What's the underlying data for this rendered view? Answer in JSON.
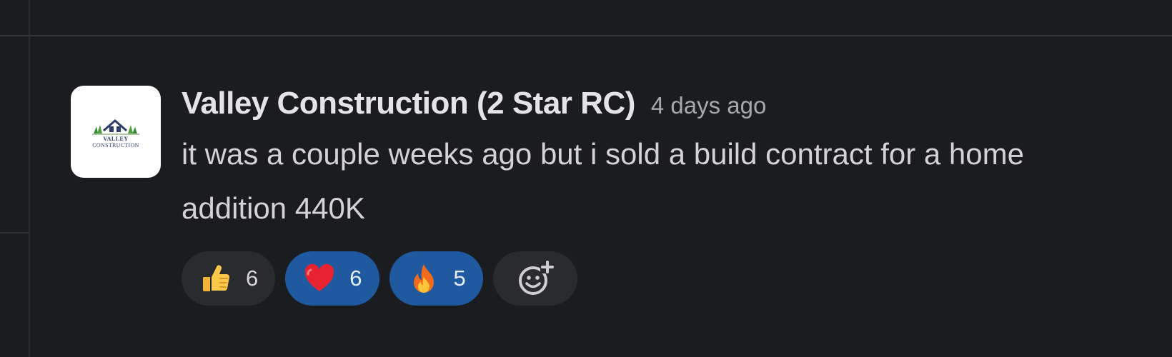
{
  "message": {
    "sender": "Valley Construction (2 Star RC)",
    "timestamp": "4 days ago",
    "text": "it was a couple weeks ago but i sold a build contract for a home addition 440K",
    "avatar": {
      "logo_line1": "VALLEY",
      "logo_line2": "CONSTRUCTION"
    }
  },
  "reactions": [
    {
      "emoji": "thumbs-up",
      "count": "6",
      "active": false
    },
    {
      "emoji": "red-heart",
      "count": "6",
      "active": true
    },
    {
      "emoji": "fire",
      "count": "5",
      "active": true
    }
  ],
  "add_reaction": {
    "icon": "add-emoji-icon"
  },
  "colors": {
    "background": "#1b1c20",
    "active_reaction": "#1f5aa1",
    "inactive_reaction": "#2a2b2f"
  }
}
